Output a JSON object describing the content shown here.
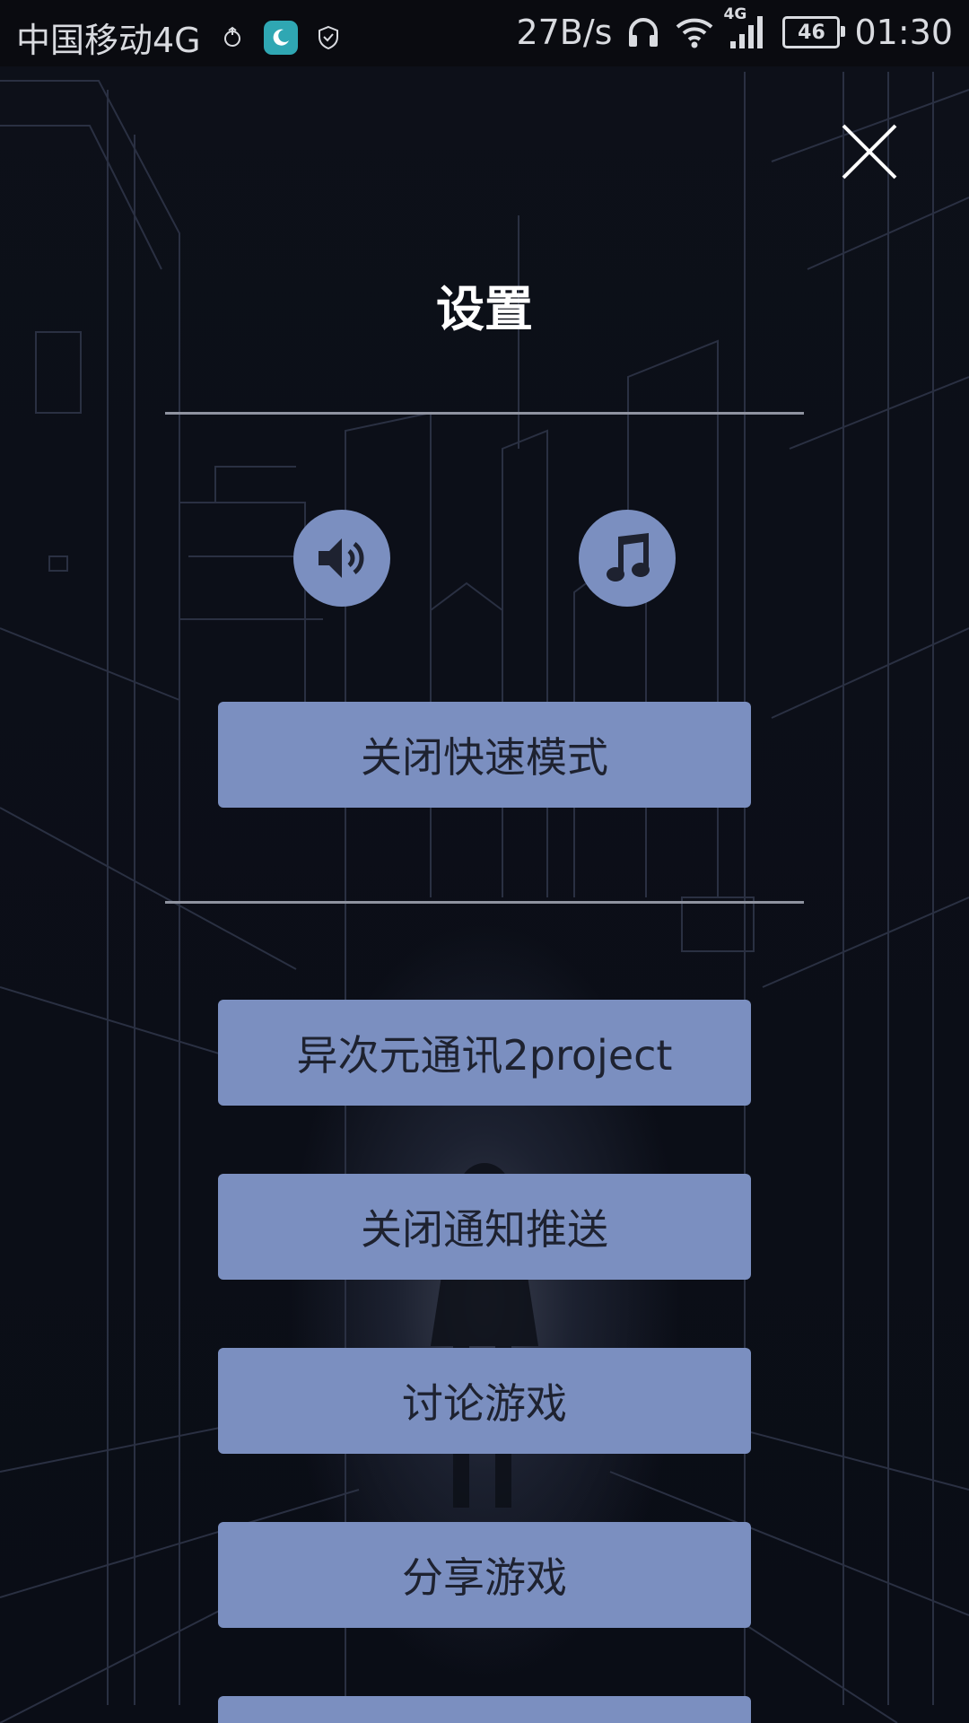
{
  "status_bar": {
    "carrier": "中国移动4G",
    "net_speed": "27B/s",
    "network_type": "4G",
    "battery": "46",
    "time": "01:30",
    "icons": [
      "sync-icon",
      "moon-icon",
      "shield-icon",
      "headphones-icon",
      "wifi-icon",
      "signal-icon",
      "battery-icon"
    ]
  },
  "page": {
    "title": "设置",
    "close_icon": "close-icon"
  },
  "toggles": {
    "sound_icon": "speaker-icon",
    "music_icon": "music-note-icon"
  },
  "buttons": {
    "fast_mode": "关闭快速模式",
    "project": "异次元通讯2project",
    "notifications": "关闭通知推送",
    "discuss": "讨论游戏",
    "share": "分享游戏"
  },
  "colors": {
    "button_bg": "#7b8fc0",
    "button_text": "#1e2230",
    "title_text": "#ffffff",
    "background": "#0b0e17"
  }
}
